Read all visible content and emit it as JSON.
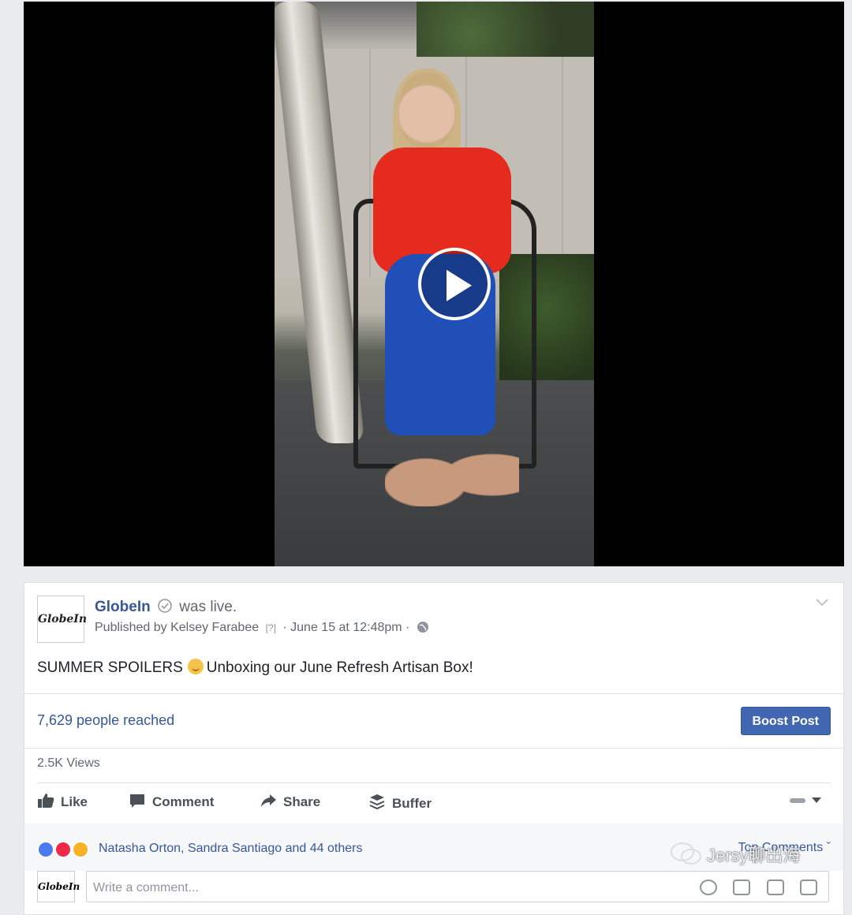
{
  "post": {
    "page_name": "GlobeIn",
    "was_live": "was live.",
    "logo_text": "GlobeIn",
    "published_by": "Published by Kelsey Farabee",
    "help_marker": "[?]",
    "date": "· June 15 at 12:48pm ·",
    "text_before_emoji": "SUMMER SPOILERS",
    "text_after_emoji": "Unboxing our June Refresh Artisan Box!"
  },
  "insights": {
    "reached": "7,629 people reached",
    "boost_label": "Boost Post",
    "views": "2.5K Views"
  },
  "actions": {
    "like": "Like",
    "comment": "Comment",
    "share": "Share",
    "buffer": "Buffer"
  },
  "reactions": {
    "likers": "Natasha Orton, Sandra Santiago and 44 others",
    "top_comments": "Top Comments ˇ",
    "colors": {
      "like": "#4a7bf0",
      "love": "#f0284a",
      "wow": "#f7b125"
    }
  },
  "comment_box": {
    "placeholder": "Write a comment..."
  },
  "watermark": {
    "text": "Jersy聊出海"
  },
  "icons": [
    "play-icon",
    "verified-icon",
    "globe-icon",
    "chevron-down-icon",
    "like-icon",
    "comment-icon",
    "share-icon",
    "buffer-icon",
    "emoji-icon",
    "camera-icon",
    "gif-icon",
    "sticker-icon"
  ]
}
